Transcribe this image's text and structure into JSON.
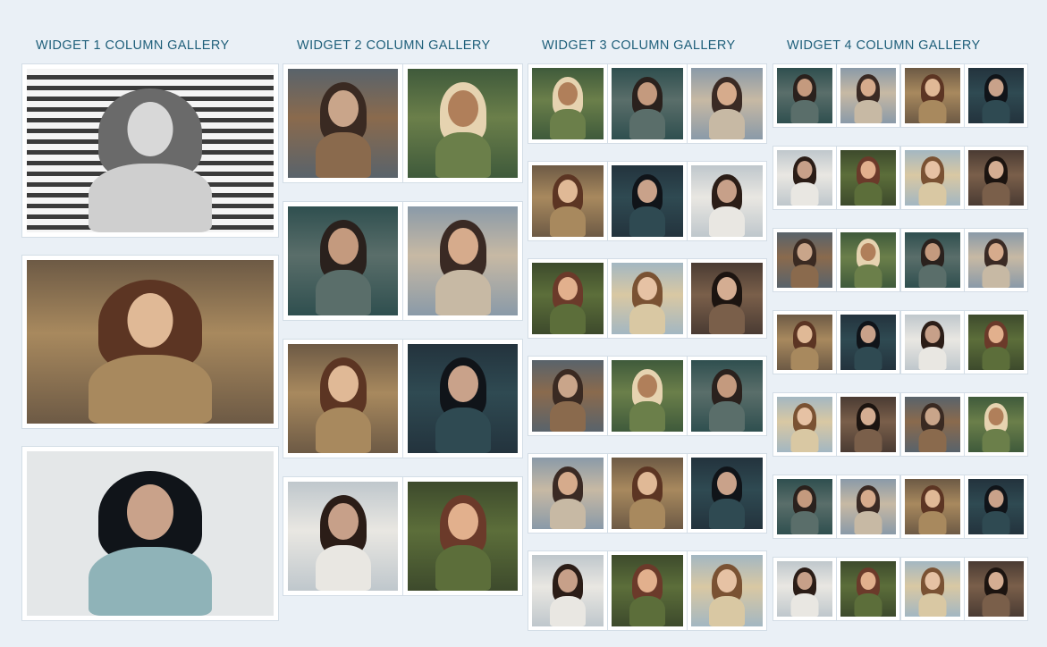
{
  "widgets": [
    {
      "title": "WIDGET 1 COLUMN GALLERY",
      "images": 3
    },
    {
      "title": "WIDGET 2 COLUMN GALLERY",
      "images": 8
    },
    {
      "title": "WIDGET 3 COLUMN GALLERY",
      "images": 18
    },
    {
      "title": "WIDGET 4 COLUMN GALLERY",
      "images": 28
    }
  ],
  "colors": {
    "background": "#eaf0f6",
    "title": "#1f5f7a",
    "frame": "#ffffff"
  }
}
